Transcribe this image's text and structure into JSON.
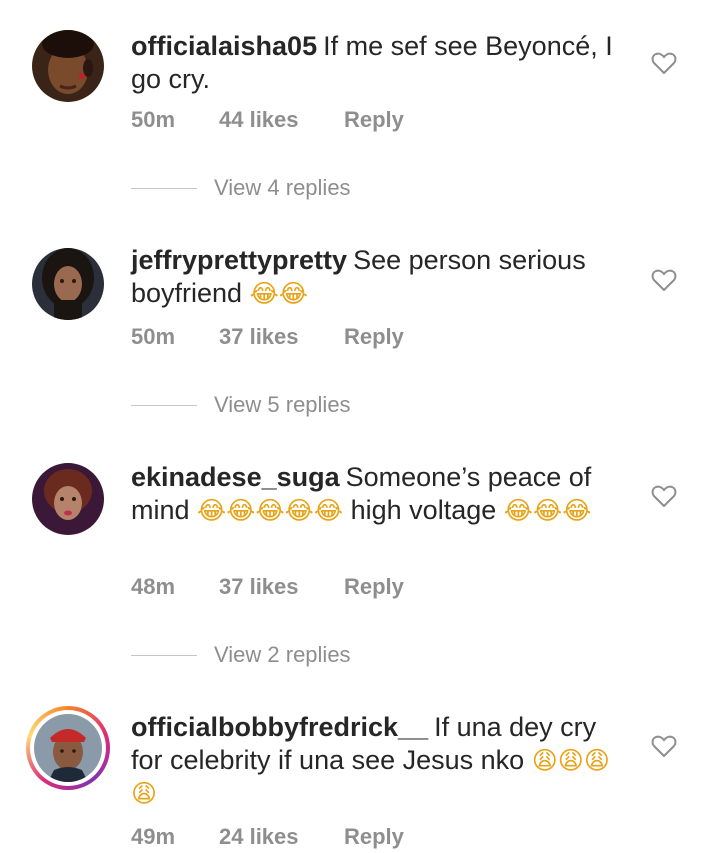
{
  "comments": [
    {
      "username": "officialaisha05",
      "text": "If me sef see Beyoncé, I go cry.",
      "emoji": "",
      "time": "50m",
      "likes": "44 likes",
      "reply": "Reply",
      "view_replies": "View 4 replies"
    },
    {
      "username": "jeffryprettypretty",
      "text": "See person serious boyfriend",
      "emoji": "😂😂",
      "time": "50m",
      "likes": "37 likes",
      "reply": "Reply",
      "view_replies": "View 5 replies"
    },
    {
      "username": "ekinadese_suga",
      "text": "Someone’s peace of mind",
      "emoji": "😂😂😂😂😂",
      "text2": "high voltage",
      "emoji2": "😂😂😂",
      "time": "48m",
      "likes": "37 likes",
      "reply": "Reply",
      "view_replies": "View 2 replies"
    },
    {
      "username": "officialbobbyfredrick__",
      "text": "If una dey cry for celebrity if una see Jesus nko",
      "emoji": "😩😩😩😩",
      "time": "49m",
      "likes": "24 likes",
      "reply": "Reply"
    }
  ],
  "icons": {
    "heart": "heart-outline-icon",
    "avatar": "avatar"
  },
  "colors": {
    "text": "#262626",
    "meta": "#8e8e8e",
    "divider": "#c7c7c7"
  }
}
